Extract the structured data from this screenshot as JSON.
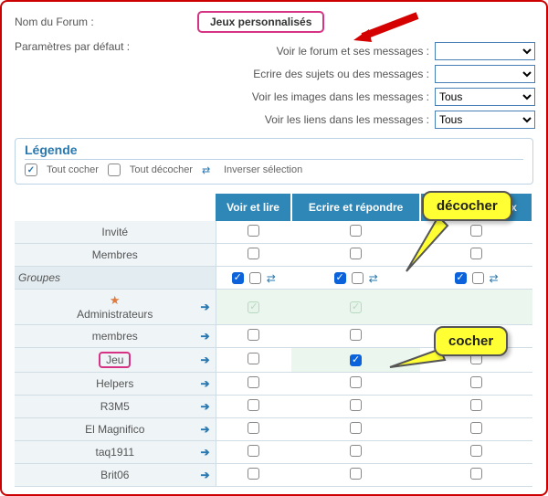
{
  "form": {
    "name_label": "Nom du Forum :",
    "name_value": "Jeux personnalisés",
    "params_label": "Paramètres par défaut :",
    "params": [
      {
        "label": "Voir le forum et ses messages :",
        "value": ""
      },
      {
        "label": "Ecrire des sujets ou des messages :",
        "value": ""
      },
      {
        "label": "Voir les images dans les messages :",
        "value": "Tous"
      },
      {
        "label": "Voir les liens dans les messages :",
        "value": "Tous"
      }
    ]
  },
  "legende": {
    "title": "Légende",
    "tout_cocher": "Tout cocher",
    "tout_decocher": "Tout décocher",
    "inverser": "Inverser sélection"
  },
  "table": {
    "headers": [
      "",
      "Voir et lire",
      "Ecrire et répondre",
      "sages speciaux"
    ],
    "rows": [
      {
        "type": "role",
        "name": "Invité",
        "c": [
          false,
          false,
          false
        ]
      },
      {
        "type": "role",
        "name": "Membres",
        "c": [
          false,
          false,
          false
        ]
      },
      {
        "type": "section",
        "name": "Groupes"
      },
      {
        "type": "group",
        "name": "Administrateurs",
        "star": true,
        "admin": true,
        "c": [
          "faint",
          "faint",
          ""
        ]
      },
      {
        "type": "group",
        "name": "membres",
        "c": [
          false,
          false,
          false
        ]
      },
      {
        "type": "group",
        "name": "Jeu",
        "highlight": true,
        "c": [
          false,
          true,
          false
        ]
      },
      {
        "type": "group",
        "name": "Helpers",
        "c": [
          false,
          false,
          false
        ]
      },
      {
        "type": "group",
        "name": "R3M5",
        "c": [
          false,
          false,
          false
        ]
      },
      {
        "type": "group",
        "name": "El Magnifico",
        "c": [
          false,
          false,
          false
        ]
      },
      {
        "type": "group",
        "name": "taq1911",
        "c": [
          false,
          false,
          false
        ]
      },
      {
        "type": "group",
        "name": "Brit06",
        "c": [
          false,
          false,
          false
        ]
      }
    ]
  },
  "callouts": {
    "decocher": "décocher",
    "cocher": "cocher"
  }
}
